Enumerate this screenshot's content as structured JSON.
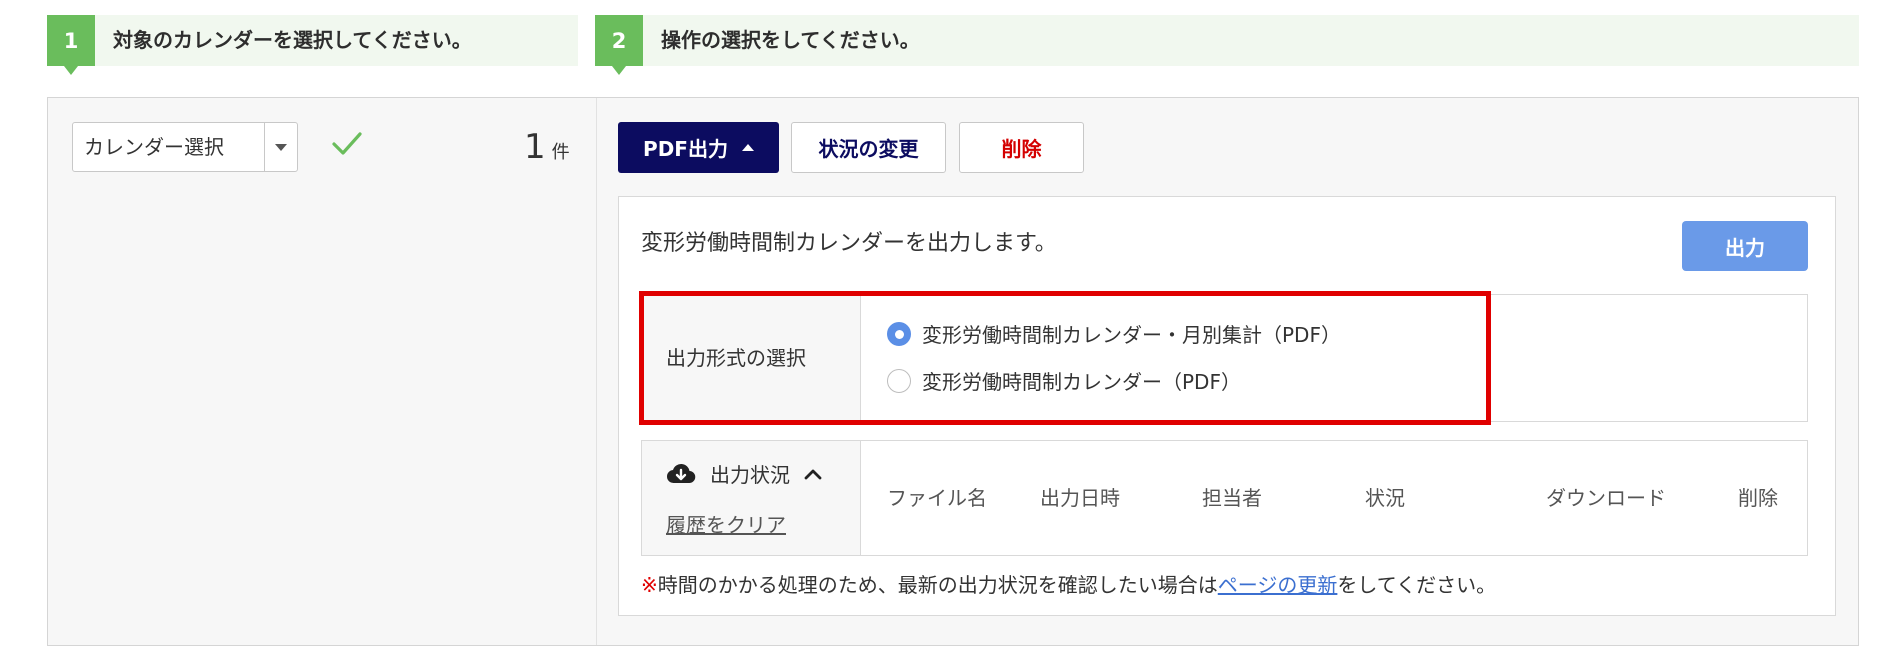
{
  "steps": [
    {
      "num": "1",
      "text": "対象のカレンダーを選択してください。"
    },
    {
      "num": "2",
      "text": "操作の選択をしてください。"
    }
  ],
  "left": {
    "select_label": "カレンダー選択",
    "count_value": "1",
    "count_unit": "件"
  },
  "actions": {
    "pdf_label": "PDF出力",
    "status_label": "状況の変更",
    "delete_label": "削除"
  },
  "pdf_panel": {
    "description": "変形労働時間制カレンダーを出力します。",
    "output_button": "出力",
    "format_label": "出力形式の選択",
    "options": [
      {
        "label": "変形労働時間制カレンダー・月別集計（PDF）",
        "selected": true
      },
      {
        "label": "変形労働時間制カレンダー（PDF）",
        "selected": false
      }
    ],
    "status_title": "出力状況",
    "clear_history": "履歴をクリア",
    "columns": [
      "ファイル名",
      "出力日時",
      "担当者",
      "状況",
      "ダウンロード",
      "削除"
    ],
    "note_mark": "※",
    "note_before": "時間のかかる処理のため、最新の出力状況を確認したい場合は",
    "note_link": "ページの更新",
    "note_after": "をしてください。"
  },
  "colors": {
    "step_green": "#6abd5c",
    "primary_navy": "#0c0c60",
    "danger_red": "#d40000",
    "output_blue": "#6a9ae8",
    "highlight_red": "#e00000",
    "link_blue": "#3b6fd0"
  }
}
